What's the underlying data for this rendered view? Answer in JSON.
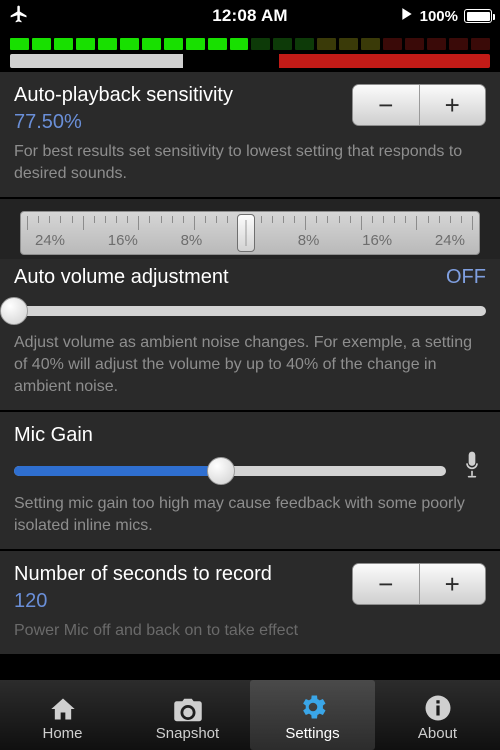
{
  "status_bar": {
    "airplane_icon": "airplane-icon",
    "time": "12:08 AM",
    "play_icon": "play-icon",
    "battery_percent": "100%",
    "battery_icon": "battery-icon"
  },
  "meter": {
    "name": "vu-meter",
    "segments": 22,
    "lit": 11,
    "level_bar": {
      "grey_pct": 36,
      "black_pct": 20,
      "red_pct": 44
    },
    "colors": {
      "green": "#18e000",
      "green_off": "#0d3a08",
      "yellow_off": "#3a3a08",
      "red_off": "#3a0a08",
      "red_on": "#c21b17",
      "grey": "#d0d0d0"
    }
  },
  "sections": {
    "sensitivity": {
      "title": "Auto-playback sensitivity",
      "value": "77.50%",
      "description": "For best results set sensitivity to lowest setting that responds to desired sounds.",
      "stepper": {
        "minus": "−",
        "plus": "+"
      },
      "ruler": {
        "labels": [
          "24%",
          "16%",
          "8%",
          "+",
          "8%",
          "16%",
          "24%"
        ],
        "knob_position_pct": 47
      }
    },
    "auto_volume": {
      "title": "Auto volume adjustment",
      "value": "OFF",
      "description": "Adjust volume as ambient noise changes. For exemple, a setting of 40% will adjust the volume by up to 40% of the change in ambient noise.",
      "slider_fill_pct": 0
    },
    "mic_gain": {
      "title": "Mic Gain",
      "description": "Setting mic gain too high may cause feedback with some poorly isolated inline mics.",
      "slider_fill_pct": 48,
      "mic_icon": "microphone-icon"
    },
    "record_seconds": {
      "title": "Number of seconds to record",
      "value": "120",
      "description": "Power Mic off and back on to take effect",
      "stepper": {
        "minus": "−",
        "plus": "+"
      }
    }
  },
  "tabbar": {
    "items": [
      {
        "label": "Home",
        "icon": "home-icon",
        "active": false
      },
      {
        "label": "Snapshot",
        "icon": "camera-icon",
        "active": false
      },
      {
        "label": "Settings",
        "icon": "gear-icon",
        "active": true
      },
      {
        "label": "About",
        "icon": "info-icon",
        "active": false
      }
    ]
  },
  "colors": {
    "accent_blue": "#6a8fd8",
    "slider_blue": "#2f6fd0",
    "panel": "#2a2a2a",
    "panel_dark": "#232323"
  }
}
